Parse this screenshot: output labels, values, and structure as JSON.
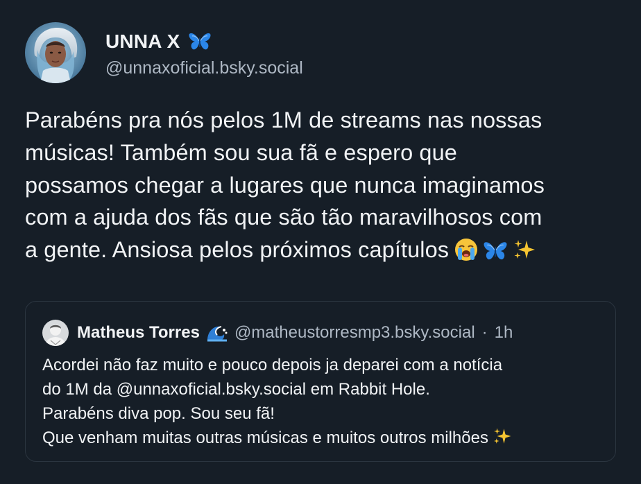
{
  "post": {
    "author": {
      "display_name": "UNNA X",
      "name_emoji": "butterfly-icon",
      "handle": "@unnaxoficial.bsky.social"
    },
    "text_lines": [
      "Parabéns pra nós pelos 1M de streams nas nossas",
      "músicas! Também sou sua fã e espero que",
      "possamos chegar a lugares que nunca imaginamos",
      "com a ajuda dos fãs que são tão maravilhosos com",
      "a gente. Ansiosa pelos próximos capítulos"
    ],
    "trailing_emojis": [
      "loudly-crying-face-icon",
      "butterfly-icon",
      "sparkles-icon"
    ]
  },
  "quote": {
    "author": {
      "display_name": "Matheus Torres",
      "name_emoji": "wave-icon",
      "handle": "@matheustorresmp3.bsky.social",
      "separator": "·",
      "time": "1h"
    },
    "text_lines": [
      "Acordei não faz muito e pouco depois ja deparei com a notícia",
      "do 1M da @unnaxoficial.bsky.social em Rabbit Hole.",
      "Parabéns diva pop. Sou seu fã!",
      "Que venham muitas outras músicas e muitos outros milhões"
    ],
    "trailing_emojis": [
      "sparkles-icon"
    ]
  },
  "colors": {
    "background": "#161e27",
    "text_primary": "#f1f3f5",
    "text_secondary": "#aeb8c4",
    "card_border": "#2b3540",
    "butterfly_blue": "#2b86e8"
  }
}
